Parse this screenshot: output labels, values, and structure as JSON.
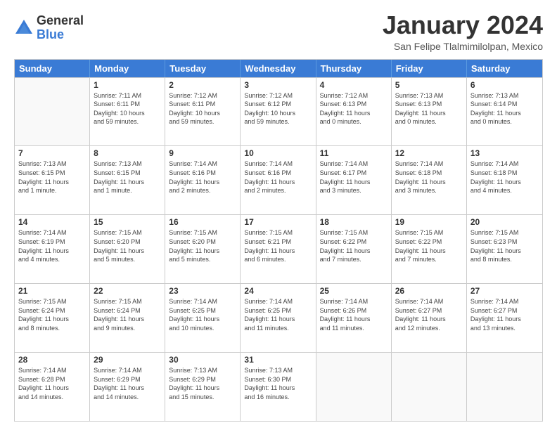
{
  "logo": {
    "general": "General",
    "blue": "Blue"
  },
  "title": "January 2024",
  "subtitle": "San Felipe Tlalmimilolpan, Mexico",
  "dayHeaders": [
    "Sunday",
    "Monday",
    "Tuesday",
    "Wednesday",
    "Thursday",
    "Friday",
    "Saturday"
  ],
  "weeks": [
    [
      {
        "day": "",
        "info": ""
      },
      {
        "day": "1",
        "info": "Sunrise: 7:11 AM\nSunset: 6:11 PM\nDaylight: 10 hours\nand 59 minutes."
      },
      {
        "day": "2",
        "info": "Sunrise: 7:12 AM\nSunset: 6:11 PM\nDaylight: 10 hours\nand 59 minutes."
      },
      {
        "day": "3",
        "info": "Sunrise: 7:12 AM\nSunset: 6:12 PM\nDaylight: 10 hours\nand 59 minutes."
      },
      {
        "day": "4",
        "info": "Sunrise: 7:12 AM\nSunset: 6:13 PM\nDaylight: 11 hours\nand 0 minutes."
      },
      {
        "day": "5",
        "info": "Sunrise: 7:13 AM\nSunset: 6:13 PM\nDaylight: 11 hours\nand 0 minutes."
      },
      {
        "day": "6",
        "info": "Sunrise: 7:13 AM\nSunset: 6:14 PM\nDaylight: 11 hours\nand 0 minutes."
      }
    ],
    [
      {
        "day": "7",
        "info": "Sunrise: 7:13 AM\nSunset: 6:15 PM\nDaylight: 11 hours\nand 1 minute."
      },
      {
        "day": "8",
        "info": "Sunrise: 7:13 AM\nSunset: 6:15 PM\nDaylight: 11 hours\nand 1 minute."
      },
      {
        "day": "9",
        "info": "Sunrise: 7:14 AM\nSunset: 6:16 PM\nDaylight: 11 hours\nand 2 minutes."
      },
      {
        "day": "10",
        "info": "Sunrise: 7:14 AM\nSunset: 6:16 PM\nDaylight: 11 hours\nand 2 minutes."
      },
      {
        "day": "11",
        "info": "Sunrise: 7:14 AM\nSunset: 6:17 PM\nDaylight: 11 hours\nand 3 minutes."
      },
      {
        "day": "12",
        "info": "Sunrise: 7:14 AM\nSunset: 6:18 PM\nDaylight: 11 hours\nand 3 minutes."
      },
      {
        "day": "13",
        "info": "Sunrise: 7:14 AM\nSunset: 6:18 PM\nDaylight: 11 hours\nand 4 minutes."
      }
    ],
    [
      {
        "day": "14",
        "info": "Sunrise: 7:14 AM\nSunset: 6:19 PM\nDaylight: 11 hours\nand 4 minutes."
      },
      {
        "day": "15",
        "info": "Sunrise: 7:15 AM\nSunset: 6:20 PM\nDaylight: 11 hours\nand 5 minutes."
      },
      {
        "day": "16",
        "info": "Sunrise: 7:15 AM\nSunset: 6:20 PM\nDaylight: 11 hours\nand 5 minutes."
      },
      {
        "day": "17",
        "info": "Sunrise: 7:15 AM\nSunset: 6:21 PM\nDaylight: 11 hours\nand 6 minutes."
      },
      {
        "day": "18",
        "info": "Sunrise: 7:15 AM\nSunset: 6:22 PM\nDaylight: 11 hours\nand 7 minutes."
      },
      {
        "day": "19",
        "info": "Sunrise: 7:15 AM\nSunset: 6:22 PM\nDaylight: 11 hours\nand 7 minutes."
      },
      {
        "day": "20",
        "info": "Sunrise: 7:15 AM\nSunset: 6:23 PM\nDaylight: 11 hours\nand 8 minutes."
      }
    ],
    [
      {
        "day": "21",
        "info": "Sunrise: 7:15 AM\nSunset: 6:24 PM\nDaylight: 11 hours\nand 8 minutes."
      },
      {
        "day": "22",
        "info": "Sunrise: 7:15 AM\nSunset: 6:24 PM\nDaylight: 11 hours\nand 9 minutes."
      },
      {
        "day": "23",
        "info": "Sunrise: 7:14 AM\nSunset: 6:25 PM\nDaylight: 11 hours\nand 10 minutes."
      },
      {
        "day": "24",
        "info": "Sunrise: 7:14 AM\nSunset: 6:25 PM\nDaylight: 11 hours\nand 11 minutes."
      },
      {
        "day": "25",
        "info": "Sunrise: 7:14 AM\nSunset: 6:26 PM\nDaylight: 11 hours\nand 11 minutes."
      },
      {
        "day": "26",
        "info": "Sunrise: 7:14 AM\nSunset: 6:27 PM\nDaylight: 11 hours\nand 12 minutes."
      },
      {
        "day": "27",
        "info": "Sunrise: 7:14 AM\nSunset: 6:27 PM\nDaylight: 11 hours\nand 13 minutes."
      }
    ],
    [
      {
        "day": "28",
        "info": "Sunrise: 7:14 AM\nSunset: 6:28 PM\nDaylight: 11 hours\nand 14 minutes."
      },
      {
        "day": "29",
        "info": "Sunrise: 7:14 AM\nSunset: 6:29 PM\nDaylight: 11 hours\nand 14 minutes."
      },
      {
        "day": "30",
        "info": "Sunrise: 7:13 AM\nSunset: 6:29 PM\nDaylight: 11 hours\nand 15 minutes."
      },
      {
        "day": "31",
        "info": "Sunrise: 7:13 AM\nSunset: 6:30 PM\nDaylight: 11 hours\nand 16 minutes."
      },
      {
        "day": "",
        "info": ""
      },
      {
        "day": "",
        "info": ""
      },
      {
        "day": "",
        "info": ""
      }
    ]
  ]
}
